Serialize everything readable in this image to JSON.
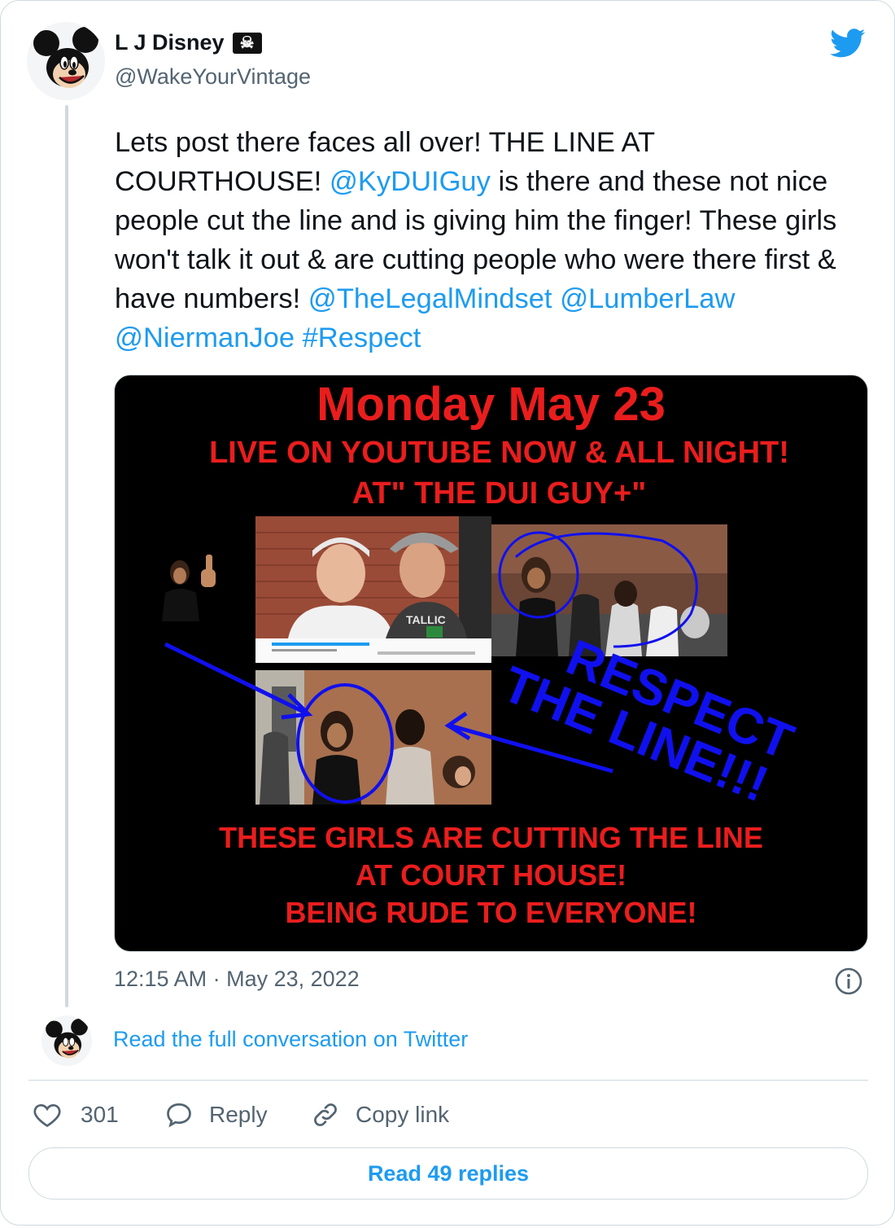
{
  "author": {
    "name": "L J Disney",
    "name_badge": "☠",
    "handle": "@WakeYourVintage"
  },
  "tweet": {
    "text_parts": {
      "p1": "Lets post there faces all over! THE LINE AT COURTHOUSE! ",
      "m1": "@KyDUIGuy",
      "p2": " is there and these not nice people cut the line and is giving him the finger! These girls won't talk it out & are cutting people who were there first & have numbers! ",
      "m2": "@TheLegalMindset",
      "m3": "@LumberLaw",
      "m4": "@NiermanJoe",
      "h1": "#Respect"
    },
    "timestamp": "12:15 AM · May 23, 2022"
  },
  "media": {
    "title": "Monday May 23",
    "line2": "LIVE ON YOUTUBE NOW & ALL NIGHT!",
    "line3": "AT\" THE  DUI GUY+\"",
    "overlay_1": "RESPECT",
    "overlay_2": "THE LINE!!!",
    "bottom_1": "THESE GIRLS ARE CUTTING THE LINE",
    "bottom_2": "AT COURT HOUSE!",
    "bottom_3": "BEING RUDE TO EVERYONE!"
  },
  "conversation": {
    "read_full": "Read the full conversation on Twitter"
  },
  "actions": {
    "likes": "301",
    "reply": "Reply",
    "copy_link": "Copy link",
    "read_replies": "Read 49 replies"
  },
  "icons": {
    "brand": "twitter-bird-icon",
    "like": "heart-icon",
    "reply": "speech-bubble-icon",
    "link": "link-icon",
    "info": "info-icon"
  },
  "colors": {
    "link": "#1d9bf0",
    "secondary": "#536471",
    "border": "#cfd9de",
    "poster_red": "#ea1d1d",
    "poster_blue": "#1010ee"
  }
}
